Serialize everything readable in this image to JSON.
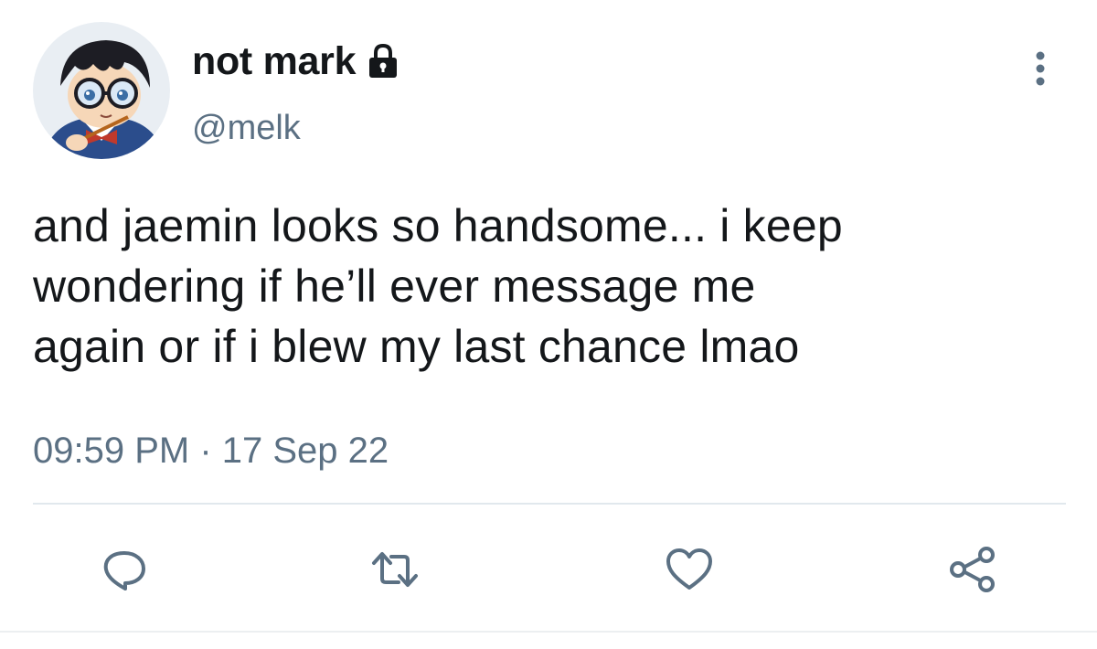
{
  "tweet": {
    "display_name": "not mark",
    "handle": "@melk",
    "text": "and jaemin looks so handsome... i keep\nwondering if he’ll ever message me\nagain or if i blew my last chance lmao",
    "timestamp": "09:59 PM · 17 Sep 22"
  },
  "icons": {
    "lock": "lock-icon",
    "more": "more-vertical-icon",
    "reply": "reply-icon",
    "retweet": "retweet-icon",
    "like": "heart-icon",
    "share": "share-icon"
  },
  "colors": {
    "text": "#14171a",
    "secondary": "#5b7083",
    "divider": "#e1e8ed",
    "background": "#ffffff"
  }
}
